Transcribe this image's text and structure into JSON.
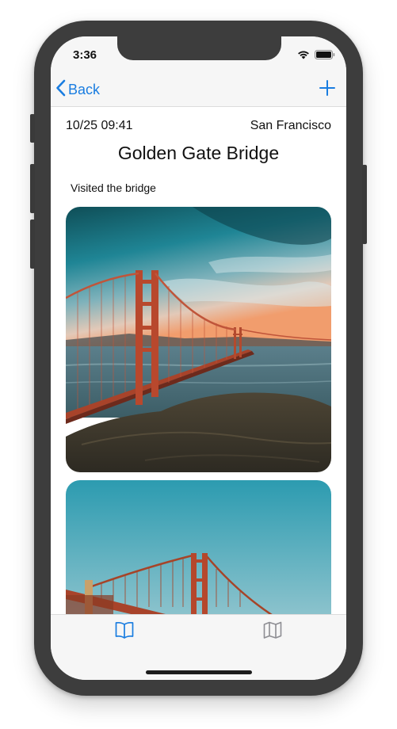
{
  "status_bar": {
    "time": "3:36",
    "wifi_icon": "wifi-icon",
    "battery_icon": "battery-icon"
  },
  "nav": {
    "back_label": "Back",
    "back_icon": "chevron-left-icon",
    "add_icon": "plus-icon"
  },
  "entry": {
    "date": "10/25 09:41",
    "location": "San Francisco",
    "title": "Golden Gate Bridge",
    "note": "Visited the bridge",
    "photos": [
      {
        "subject": "golden-gate-bridge-sunset"
      },
      {
        "subject": "golden-gate-bridge-blue-sky"
      }
    ]
  },
  "tab_bar": {
    "items": [
      {
        "icon": "book-icon",
        "selected": true
      },
      {
        "icon": "map-icon",
        "selected": false
      }
    ]
  },
  "colors": {
    "accent": "#1a7de0",
    "inactive_tab": "#8e8e93",
    "bar_background": "#f6f6f6"
  }
}
